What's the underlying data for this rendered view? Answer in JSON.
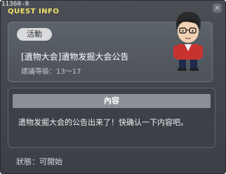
{
  "window": {
    "id_tag": "11360-0",
    "title": "QUEST INFO",
    "close_label": "×"
  },
  "quest": {
    "category_tag": "活動",
    "name": "[遺物大会]遺物发掘大会公告",
    "level_label": "建議等級：13～17",
    "npc_icon": "npc-portrait-icon"
  },
  "content": {
    "header": "內容",
    "text": "遗物发掘大会的公告出来了！快确认一下内容吧。"
  },
  "status": {
    "label": "狀態：可開始"
  },
  "colors": {
    "title": "#f2e36a",
    "panel": "#5d636b",
    "header": "#8b9096"
  }
}
